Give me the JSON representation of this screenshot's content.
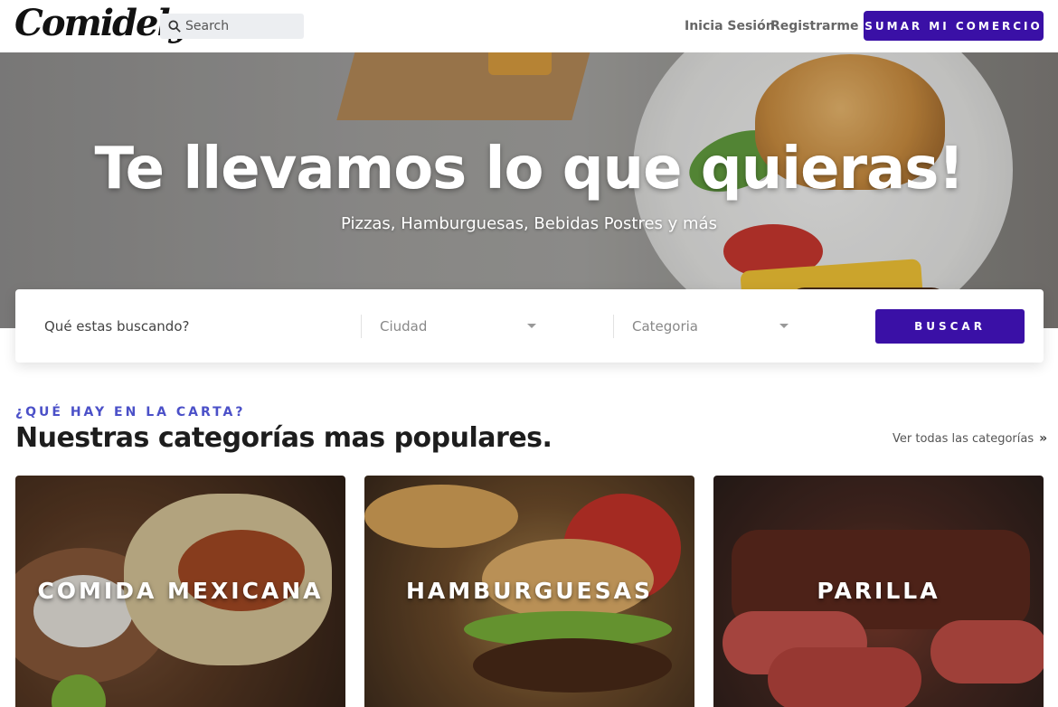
{
  "header": {
    "logo": "Comidely",
    "search_placeholder": "Search",
    "login_label": "Inicia Sesión",
    "register_label": "Registrarme",
    "cta_label": "SUMAR MI COMERCIO"
  },
  "hero": {
    "title": "Te llevamos lo que quieras!",
    "subtitle": "Pizzas, Hamburguesas, Bebidas Postres y más"
  },
  "search_panel": {
    "query_placeholder": "Qué estas buscando?",
    "city_selected": "Ciudad",
    "category_selected": "Categoria",
    "button_label": "BUSCAR"
  },
  "categories_section": {
    "kicker": "¿QUÉ HAY EN LA CARTA?",
    "title": "Nuestras categorías mas populares.",
    "see_all_label": "Ver todas las categorías",
    "cards": [
      {
        "label": "COMIDA MEXICANA"
      },
      {
        "label": "HAMBURGUESAS"
      },
      {
        "label": "PARILLA"
      }
    ]
  },
  "colors": {
    "accent": "#3a10a6",
    "kicker": "#4b50c8"
  },
  "icons": {
    "search": "search-icon",
    "caret": "caret-down-icon",
    "double_chevron": "double-chevron-right-icon"
  }
}
